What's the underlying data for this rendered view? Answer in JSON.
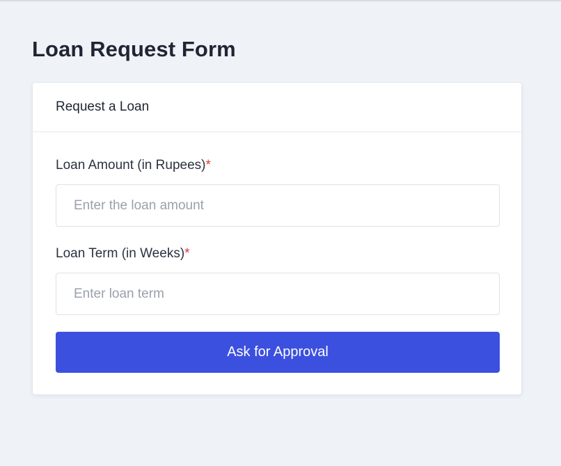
{
  "page": {
    "title": "Loan Request Form"
  },
  "card": {
    "header_title": "Request a Loan",
    "fields": {
      "amount": {
        "label": "Loan Amount (in Rupees)",
        "required_mark": "*",
        "value": "",
        "placeholder": "Enter the loan amount"
      },
      "term": {
        "label": "Loan Term (in Weeks)",
        "required_mark": "*",
        "value": "",
        "placeholder": "Enter loan term"
      }
    },
    "submit_label": "Ask for Approval"
  },
  "colors": {
    "background": "#eff2f7",
    "card": "#ffffff",
    "primary_button": "#3c50e0",
    "required": "#d93a3a",
    "text": "#1f2533",
    "placeholder": "#9aa0ab"
  }
}
